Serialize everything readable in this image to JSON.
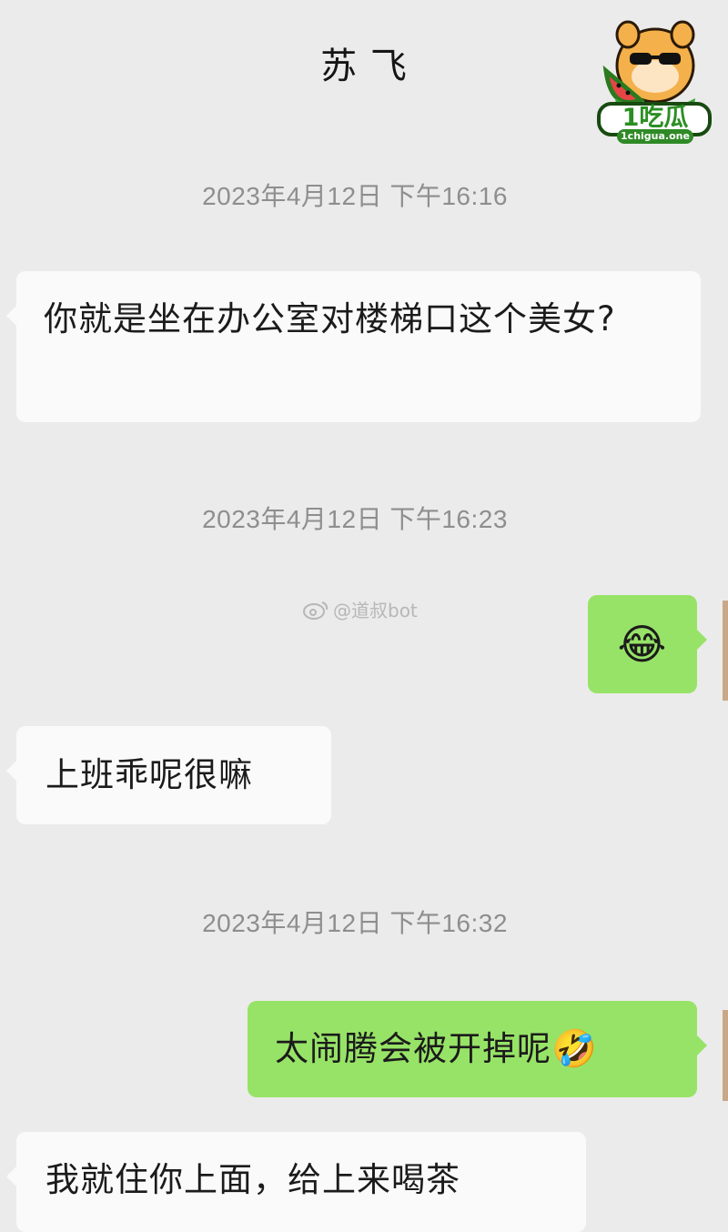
{
  "header": {
    "title": "苏 飞"
  },
  "watermark": {
    "text": "@道叔bot",
    "icon": "weibo-icon"
  },
  "logo": {
    "main_text": "1吃瓜",
    "sub_text": "1chigua.one",
    "icon": "hamster-watermelon-mascot-icon"
  },
  "messages": [
    {
      "type": "timestamp",
      "text": "2023年4月12日 下午16:16"
    },
    {
      "type": "incoming",
      "text": "你就是坐在办公室对楼梯口这个美女?"
    },
    {
      "type": "timestamp",
      "text": "2023年4月12日 下午16:23"
    },
    {
      "type": "outgoing",
      "emoji": "😂",
      "icon": "tears-of-joy-emoji-icon"
    },
    {
      "type": "incoming",
      "text": "上班乖呢很嘛"
    },
    {
      "type": "timestamp",
      "text": "2023年4月12日 下午16:32"
    },
    {
      "type": "outgoing",
      "text": "太闹腾会被开掉呢",
      "emoji": "🤣",
      "icon": "rolling-laugh-emoji-icon"
    },
    {
      "type": "incoming",
      "text": "我就住你上面，给上来喝茶"
    }
  ],
  "colors": {
    "background": "#ebebeb",
    "incoming_bubble": "#fafafa",
    "outgoing_bubble": "#97e367",
    "timestamp": "#8e8e8e"
  }
}
